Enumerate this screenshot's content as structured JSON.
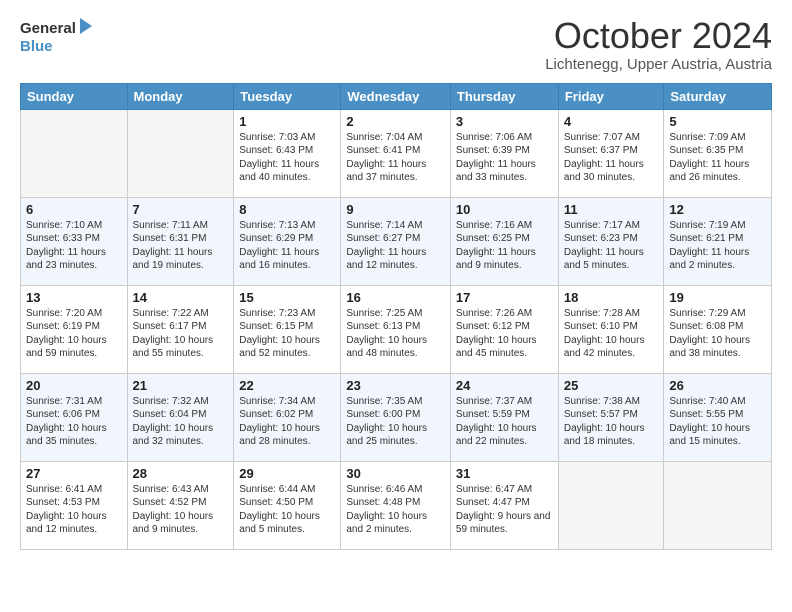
{
  "logo": {
    "line1": "General",
    "line2": "Blue"
  },
  "title": "October 2024",
  "location": "Lichtenegg, Upper Austria, Austria",
  "days_header": [
    "Sunday",
    "Monday",
    "Tuesday",
    "Wednesday",
    "Thursday",
    "Friday",
    "Saturday"
  ],
  "weeks": [
    [
      {
        "day": "",
        "info": ""
      },
      {
        "day": "",
        "info": ""
      },
      {
        "day": "1",
        "info": "Sunrise: 7:03 AM\nSunset: 6:43 PM\nDaylight: 11 hours and 40 minutes."
      },
      {
        "day": "2",
        "info": "Sunrise: 7:04 AM\nSunset: 6:41 PM\nDaylight: 11 hours and 37 minutes."
      },
      {
        "day": "3",
        "info": "Sunrise: 7:06 AM\nSunset: 6:39 PM\nDaylight: 11 hours and 33 minutes."
      },
      {
        "day": "4",
        "info": "Sunrise: 7:07 AM\nSunset: 6:37 PM\nDaylight: 11 hours and 30 minutes."
      },
      {
        "day": "5",
        "info": "Sunrise: 7:09 AM\nSunset: 6:35 PM\nDaylight: 11 hours and 26 minutes."
      }
    ],
    [
      {
        "day": "6",
        "info": "Sunrise: 7:10 AM\nSunset: 6:33 PM\nDaylight: 11 hours and 23 minutes."
      },
      {
        "day": "7",
        "info": "Sunrise: 7:11 AM\nSunset: 6:31 PM\nDaylight: 11 hours and 19 minutes."
      },
      {
        "day": "8",
        "info": "Sunrise: 7:13 AM\nSunset: 6:29 PM\nDaylight: 11 hours and 16 minutes."
      },
      {
        "day": "9",
        "info": "Sunrise: 7:14 AM\nSunset: 6:27 PM\nDaylight: 11 hours and 12 minutes."
      },
      {
        "day": "10",
        "info": "Sunrise: 7:16 AM\nSunset: 6:25 PM\nDaylight: 11 hours and 9 minutes."
      },
      {
        "day": "11",
        "info": "Sunrise: 7:17 AM\nSunset: 6:23 PM\nDaylight: 11 hours and 5 minutes."
      },
      {
        "day": "12",
        "info": "Sunrise: 7:19 AM\nSunset: 6:21 PM\nDaylight: 11 hours and 2 minutes."
      }
    ],
    [
      {
        "day": "13",
        "info": "Sunrise: 7:20 AM\nSunset: 6:19 PM\nDaylight: 10 hours and 59 minutes."
      },
      {
        "day": "14",
        "info": "Sunrise: 7:22 AM\nSunset: 6:17 PM\nDaylight: 10 hours and 55 minutes."
      },
      {
        "day": "15",
        "info": "Sunrise: 7:23 AM\nSunset: 6:15 PM\nDaylight: 10 hours and 52 minutes."
      },
      {
        "day": "16",
        "info": "Sunrise: 7:25 AM\nSunset: 6:13 PM\nDaylight: 10 hours and 48 minutes."
      },
      {
        "day": "17",
        "info": "Sunrise: 7:26 AM\nSunset: 6:12 PM\nDaylight: 10 hours and 45 minutes."
      },
      {
        "day": "18",
        "info": "Sunrise: 7:28 AM\nSunset: 6:10 PM\nDaylight: 10 hours and 42 minutes."
      },
      {
        "day": "19",
        "info": "Sunrise: 7:29 AM\nSunset: 6:08 PM\nDaylight: 10 hours and 38 minutes."
      }
    ],
    [
      {
        "day": "20",
        "info": "Sunrise: 7:31 AM\nSunset: 6:06 PM\nDaylight: 10 hours and 35 minutes."
      },
      {
        "day": "21",
        "info": "Sunrise: 7:32 AM\nSunset: 6:04 PM\nDaylight: 10 hours and 32 minutes."
      },
      {
        "day": "22",
        "info": "Sunrise: 7:34 AM\nSunset: 6:02 PM\nDaylight: 10 hours and 28 minutes."
      },
      {
        "day": "23",
        "info": "Sunrise: 7:35 AM\nSunset: 6:00 PM\nDaylight: 10 hours and 25 minutes."
      },
      {
        "day": "24",
        "info": "Sunrise: 7:37 AM\nSunset: 5:59 PM\nDaylight: 10 hours and 22 minutes."
      },
      {
        "day": "25",
        "info": "Sunrise: 7:38 AM\nSunset: 5:57 PM\nDaylight: 10 hours and 18 minutes."
      },
      {
        "day": "26",
        "info": "Sunrise: 7:40 AM\nSunset: 5:55 PM\nDaylight: 10 hours and 15 minutes."
      }
    ],
    [
      {
        "day": "27",
        "info": "Sunrise: 6:41 AM\nSunset: 4:53 PM\nDaylight: 10 hours and 12 minutes."
      },
      {
        "day": "28",
        "info": "Sunrise: 6:43 AM\nSunset: 4:52 PM\nDaylight: 10 hours and 9 minutes."
      },
      {
        "day": "29",
        "info": "Sunrise: 6:44 AM\nSunset: 4:50 PM\nDaylight: 10 hours and 5 minutes."
      },
      {
        "day": "30",
        "info": "Sunrise: 6:46 AM\nSunset: 4:48 PM\nDaylight: 10 hours and 2 minutes."
      },
      {
        "day": "31",
        "info": "Sunrise: 6:47 AM\nSunset: 4:47 PM\nDaylight: 9 hours and 59 minutes."
      },
      {
        "day": "",
        "info": ""
      },
      {
        "day": "",
        "info": ""
      }
    ]
  ]
}
